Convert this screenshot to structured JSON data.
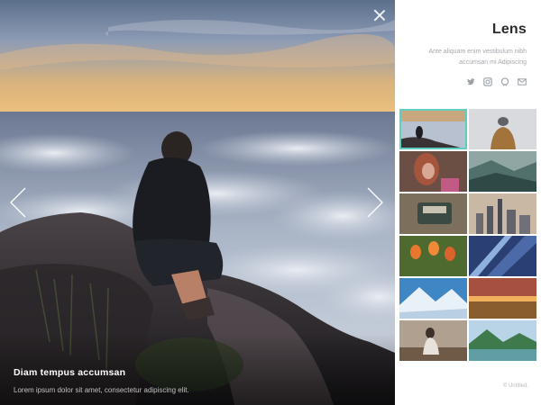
{
  "viewer": {
    "caption_title": "Diam tempus accumsan",
    "caption_text": "Lorem ipsum dolor sit amet, consectetur adipiscing elit."
  },
  "panel": {
    "brand": "Lens",
    "tagline": "Ante aliquam enim vestibulum nibh accumsan mi Adipiscing",
    "socials": [
      "twitter-icon",
      "instagram-icon",
      "github-icon",
      "envelope-icon"
    ],
    "copyright": "© Untitled."
  },
  "thumbnails": [
    "person-on-cliff-above-clouds",
    "person-in-grey-beanie",
    "woman-with-red-hair",
    "misty-mountain-valley",
    "desk-with-typewriter",
    "city-skyline-at-dusk",
    "orange-tulips",
    "glass-building-corner",
    "snowy-mountain-peak",
    "sunset-over-field",
    "person-seated-indoors",
    "green-mountain-lake"
  ],
  "active_thumbnail": 0,
  "colors": {
    "accent": "#5ecfc2",
    "brand_text": "#2b2b2b",
    "muted_text": "#a5a8ad"
  }
}
